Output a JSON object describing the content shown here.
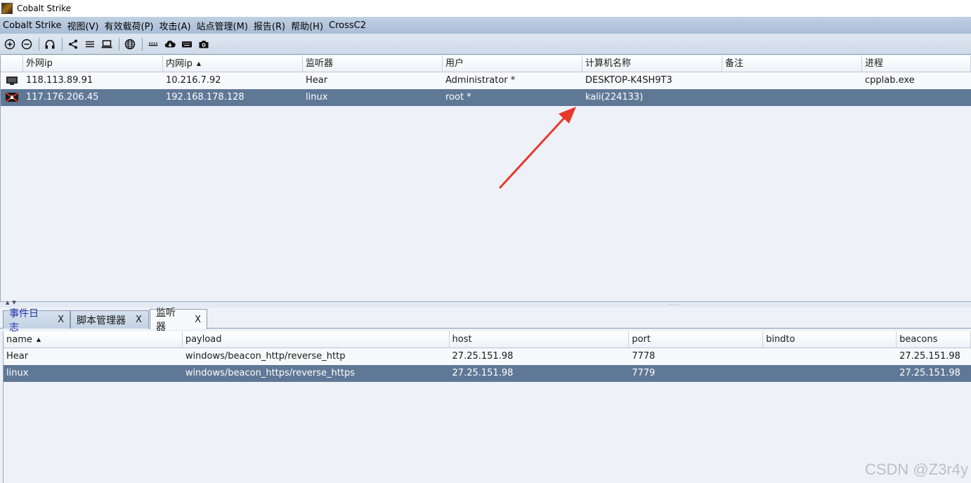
{
  "window": {
    "title": "Cobalt Strike"
  },
  "menubar": {
    "items": [
      "Cobalt Strike",
      "视图(V)",
      "有效载荷(P)",
      "攻击(A)",
      "站点管理(M)",
      "报告(R)",
      "帮助(H)",
      "CrossC2"
    ]
  },
  "toolbar": {
    "buttons": [
      "add-icon",
      "remove-icon",
      "headphones-icon",
      "share-icon",
      "list-icon",
      "laptop-icon",
      "globe-icon",
      "dots-icon",
      "cloud-download-icon",
      "keyboard-icon",
      "camera-icon"
    ]
  },
  "sessions": {
    "columns": [
      "外网ip",
      "内网ip",
      "监听器",
      "用户",
      "计算机名称",
      "备注",
      "进程"
    ],
    "sort_indicator": "▲",
    "rows": [
      {
        "external": "118.113.89.91",
        "internal": "10.216.7.92",
        "listener": "Hear",
        "user": "Administrator *",
        "computer": "DESKTOP-K4SH9T3",
        "note": "",
        "process": "cpplab.exe",
        "icon": "windows-session-icon"
      },
      {
        "external": "117.176.206.45",
        "internal": "192.168.178.128",
        "listener": "linux",
        "user": "root *",
        "computer": "kali(224133)",
        "note": "",
        "process": "",
        "icon": "linux-session-icon"
      }
    ],
    "selected_row": 1
  },
  "tabs": [
    {
      "label": "事件日志",
      "close": "X"
    },
    {
      "label": "脚本管理器",
      "close": "X"
    },
    {
      "label": "监听器",
      "close": "X"
    }
  ],
  "active_tab": 2,
  "listeners": {
    "columns": [
      "name",
      "payload",
      "host",
      "port",
      "bindto",
      "beacons"
    ],
    "sort_indicator": "▲",
    "rows": [
      {
        "name": "Hear",
        "payload": "windows/beacon_http/reverse_http",
        "host": "27.25.151.98",
        "port": "7778",
        "bindto": "",
        "beacons": "27.25.151.98"
      },
      {
        "name": "linux",
        "payload": "windows/beacon_https/reverse_https",
        "host": "27.25.151.98",
        "port": "7779",
        "bindto": "",
        "beacons": "27.25.151.98"
      }
    ],
    "selected_row": 1
  },
  "watermark": "CSDN @Z3r4y",
  "colors": {
    "selection": "#5f7896",
    "menubar": "#b3c5dc",
    "arrow": "#e8382c"
  }
}
